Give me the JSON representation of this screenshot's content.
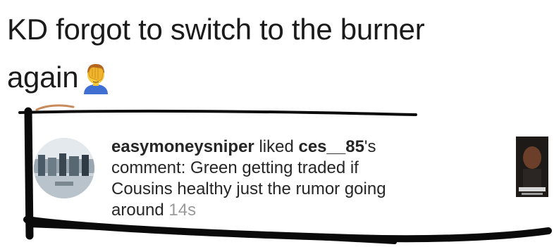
{
  "caption": {
    "line1": "KD forgot to switch to the burner",
    "line2": "again",
    "emoji": "face-palm-icon"
  },
  "notification": {
    "username": "easymoneysniper",
    "action": " liked ",
    "target_user": "ces__85",
    "text_a": "'s",
    "text_b": "comment: Green getting traded if",
    "text_c": "Cousins healthy just the rumor going",
    "text_d": "around",
    "timestamp": "14s"
  },
  "colors": {
    "text": "#262626",
    "timestamp": "#9a9a9a",
    "marker": "#0a0a0a"
  }
}
